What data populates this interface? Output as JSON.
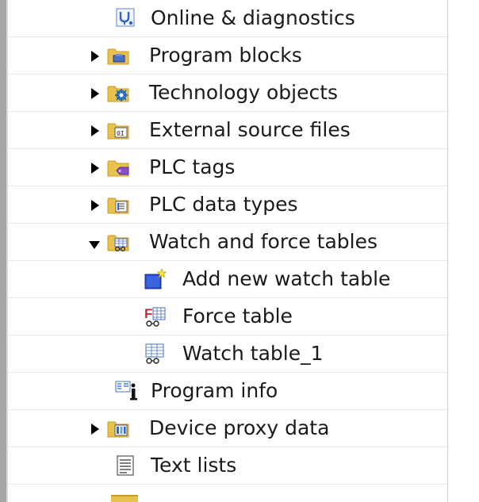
{
  "tree": {
    "items": [
      {
        "label": "Online & diagnostics",
        "icon": "online-diagnostics-icon",
        "expander": "none",
        "indent": 1
      },
      {
        "label": "Program blocks",
        "icon": "folder-program-blocks-icon",
        "expander": "collapsed",
        "indent": 1
      },
      {
        "label": "Technology objects",
        "icon": "folder-technology-objects-icon",
        "expander": "collapsed",
        "indent": 1
      },
      {
        "label": "External source files",
        "icon": "folder-external-source-icon",
        "expander": "collapsed",
        "indent": 1
      },
      {
        "label": "PLC tags",
        "icon": "folder-plc-tags-icon",
        "expander": "collapsed",
        "indent": 1
      },
      {
        "label": "PLC data types",
        "icon": "folder-plc-data-types-icon",
        "expander": "collapsed",
        "indent": 1
      },
      {
        "label": "Watch and force tables",
        "icon": "folder-watch-force-icon",
        "expander": "expanded",
        "indent": 1
      },
      {
        "label": "Add new watch table",
        "icon": "add-new-icon",
        "expander": "none",
        "indent": 2
      },
      {
        "label": "Force table",
        "icon": "force-table-icon",
        "expander": "none",
        "indent": 2
      },
      {
        "label": "Watch table_1",
        "icon": "watch-table-icon",
        "expander": "none",
        "indent": 2
      },
      {
        "label": "Program info",
        "icon": "program-info-icon",
        "expander": "none",
        "indent": 1
      },
      {
        "label": "Device proxy data",
        "icon": "folder-device-proxy-icon",
        "expander": "collapsed",
        "indent": 1
      },
      {
        "label": "Text lists",
        "icon": "text-lists-icon",
        "expander": "none",
        "indent": 1
      }
    ]
  },
  "colors": {
    "folder": "#e8c24f",
    "folder_dark": "#c89a26",
    "accent_blue": "#2f66c8",
    "accent_red": "#c8282d",
    "text": "#1a1a1a"
  }
}
